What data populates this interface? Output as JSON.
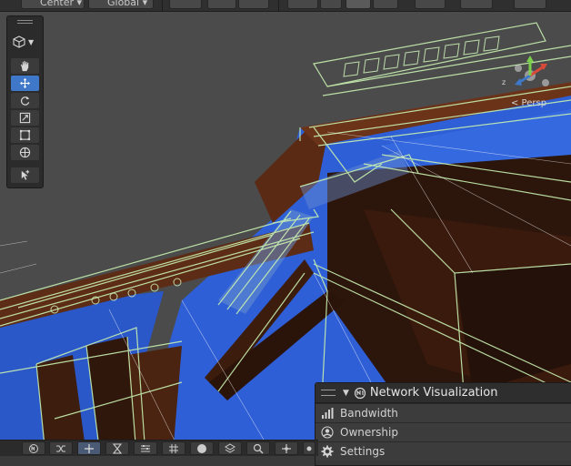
{
  "top_toolbar": {
    "pivot_label": "Center",
    "space_label": "Global"
  },
  "tools": {
    "items": [
      {
        "name": "hand-tool",
        "icon": "hand-icon"
      },
      {
        "name": "move-tool",
        "icon": "move-arrows-icon",
        "active": true
      },
      {
        "name": "rotate-tool",
        "icon": "rotate-icon"
      },
      {
        "name": "scale-tool",
        "icon": "scale-icon"
      },
      {
        "name": "rect-tool",
        "icon": "rect-icon"
      },
      {
        "name": "transform-tool",
        "icon": "transform-icon"
      },
      {
        "name": "custom-tool",
        "icon": "custom-tool-icon"
      }
    ]
  },
  "gizmo": {
    "projection_label": "< Persp"
  },
  "network_panel": {
    "title": "Network Visualization",
    "rows": [
      {
        "label": "Bandwidth",
        "icon": "bar-chart-icon"
      },
      {
        "label": "Ownership",
        "icon": "user-circle-icon"
      },
      {
        "label": "Settings",
        "icon": "gear-icon"
      }
    ]
  },
  "colors": {
    "accent": "#3f78c8",
    "wireframe": "#c8f0b0",
    "water": "#2e5fd6",
    "wood": "#3a1a0c"
  }
}
